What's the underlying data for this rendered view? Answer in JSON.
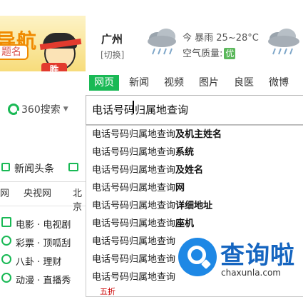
{
  "banner": {
    "logo_text": "导航",
    "logo_sub": "题名",
    "mascot_badge": "胜",
    "city": "广州",
    "switch_label": "[切换]",
    "weather_text": "今 暴雨  25~28°C",
    "aqi_label": "空气质量:",
    "aqi_value": "优"
  },
  "tabs": [
    "网页",
    "新闻",
    "视频",
    "图片",
    "良医",
    "微博"
  ],
  "search": {
    "brand": "360搜索",
    "query": "电话号码归属地查询"
  },
  "suggestions": [
    {
      "prefix": "电话号码归属地查询",
      "suffix": "及机主姓名"
    },
    {
      "prefix": "电话号码归属地查询",
      "suffix": "系统"
    },
    {
      "prefix": "电话号码归属地查询",
      "suffix": "及姓名"
    },
    {
      "prefix": "电话号码归属地查询",
      "suffix": "网"
    },
    {
      "prefix": "电话号码归属地查询",
      "suffix": "详细地址"
    },
    {
      "prefix": "电话号码归属地查询",
      "suffix": "座机"
    },
    {
      "prefix": "电话号码归属地查询",
      "suffix": ""
    },
    {
      "prefix": "电话号码归属地查询",
      "suffix": ""
    },
    {
      "prefix": "电话号码归属地查询",
      "suffix": ""
    }
  ],
  "left": {
    "news_label": "新闻头条",
    "sites": [
      "网",
      "央视网",
      "北京"
    ],
    "side_items": [
      "电影 · 电视剧",
      "彩票 · 顶呱刮",
      "八卦 · 理财",
      "动漫 · 直播秀"
    ]
  },
  "bottom_text": "五折",
  "watermark": {
    "title": "查询啦",
    "url": "chaxunla.com"
  },
  "colors": {
    "accent": "#19b955",
    "watermark": "#1e88e5"
  }
}
